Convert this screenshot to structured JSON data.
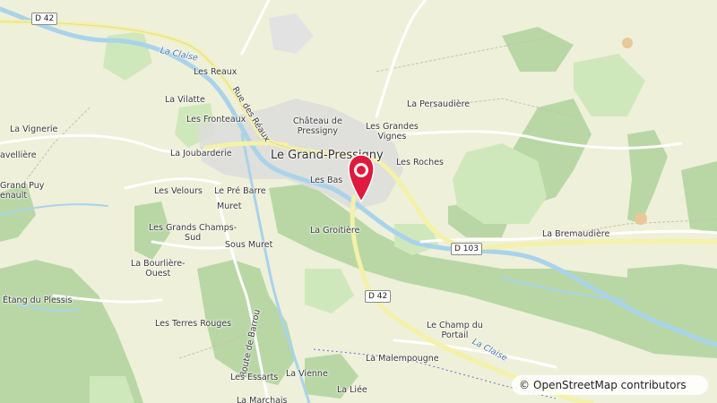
{
  "map": {
    "attribution": {
      "symbol": "©",
      "text": "OpenStreetMap contributors"
    },
    "marker": {
      "icon": "map-pin-icon",
      "color": "#e0193e"
    },
    "colors": {
      "background": "#eef0d9",
      "forest": "#b8d7a5",
      "meadow": "#cfe8bb",
      "water": "#a9d3eb",
      "urban": "#dcdcdc",
      "road_major": "#f4f1a8"
    },
    "road_shields": [
      {
        "id": "d42_nw",
        "label": "D 42"
      },
      {
        "id": "d42_s",
        "label": "D 42"
      },
      {
        "id": "d103",
        "label": "D 103"
      }
    ],
    "town": "Le Grand-Pressigny",
    "water_labels": {
      "claise_north": "La Claise",
      "claise_south": "La Claise"
    },
    "street_labels": {
      "rue_des_reaux": "Rue des Réaux",
      "route_de_barrou": "Route de Barrou"
    },
    "places": {
      "les_reaux": "Les Reaux",
      "la_vilatte": "La Vilatte",
      "les_fronteaux": "Les Fronteaux",
      "la_vignerie": "La Vignerie",
      "avelliere": "avellière",
      "grand_puy_1": "Grand Puy",
      "grand_puy_2": "enault",
      "la_joubarderie": "La Joubarderie",
      "chateau_1": "Château de",
      "chateau_2": "Pressigny",
      "les_grandes_vignes_1": "Les Grandes",
      "les_grandes_vignes_2": "Vignes",
      "la_persaudiere": "La Persaudière",
      "les_roches": "Les Roches",
      "les_velours": "Les Velours",
      "le_pre_barre": "Le Pré Barre",
      "muret": "Muret",
      "les_bas": "Les Bas",
      "les_grands_champs_1": "Les Grands Champs-",
      "les_grands_champs_2": "Sud",
      "la_groitiere": "La Groitière",
      "la_bourliere_1": "La Bourlière-",
      "la_bourliere_2": "Ouest",
      "sous_muret": "Sous Muret",
      "la_bremaudiere": "La Bremaudière",
      "etang_du_plessis": "Étang du Plessis",
      "les_terres_rouges": "Les Terres Rouges",
      "le_champ_du_portail_1": "Le Champ du",
      "le_champ_du_portail_2": "Portail",
      "la_malempougne": "La Malempougne",
      "la_vienne": "La Vienne",
      "les_essarts": "Les Essarts",
      "la_liee": "La Liée",
      "la_marchais": "La Marchais"
    }
  }
}
